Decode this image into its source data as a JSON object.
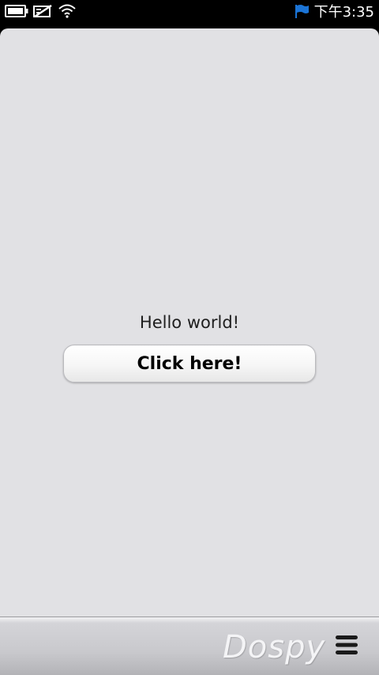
{
  "status_bar": {
    "time": "下午3:35",
    "icons": [
      "battery-icon",
      "no-sim-icon",
      "wifi-icon",
      "flag-notification-icon"
    ],
    "flag_color": "#1b74d6"
  },
  "main": {
    "greeting": "Hello world!",
    "button_label": "Click here!",
    "background_color": "#e1e1e4"
  },
  "toolbar": {
    "watermark": "Dospy",
    "menu_icon": "menu-icon"
  }
}
